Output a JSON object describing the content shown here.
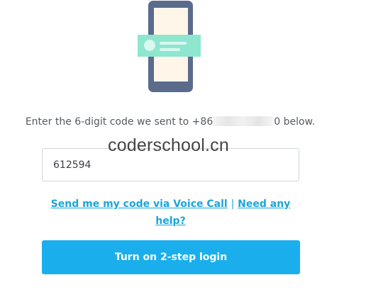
{
  "instruction": {
    "prefix": "Enter the 6-digit code we sent to +86",
    "suffix": "0 below."
  },
  "watermark": "coderschool.cn",
  "code_input": {
    "value": "612594"
  },
  "links": {
    "voice_call": "Send me my code via Voice Call",
    "separator": "|",
    "help": "Need any help?"
  },
  "submit_button": {
    "label": "Turn on 2-step login"
  },
  "colors": {
    "accent": "#1aafec",
    "link": "#1aa5d9",
    "phone_frame": "#5a6b8c",
    "phone_screen": "#fff6ea",
    "message_card": "#8ee6cf"
  },
  "icons": {
    "illustration": "phone-with-message-icon"
  }
}
